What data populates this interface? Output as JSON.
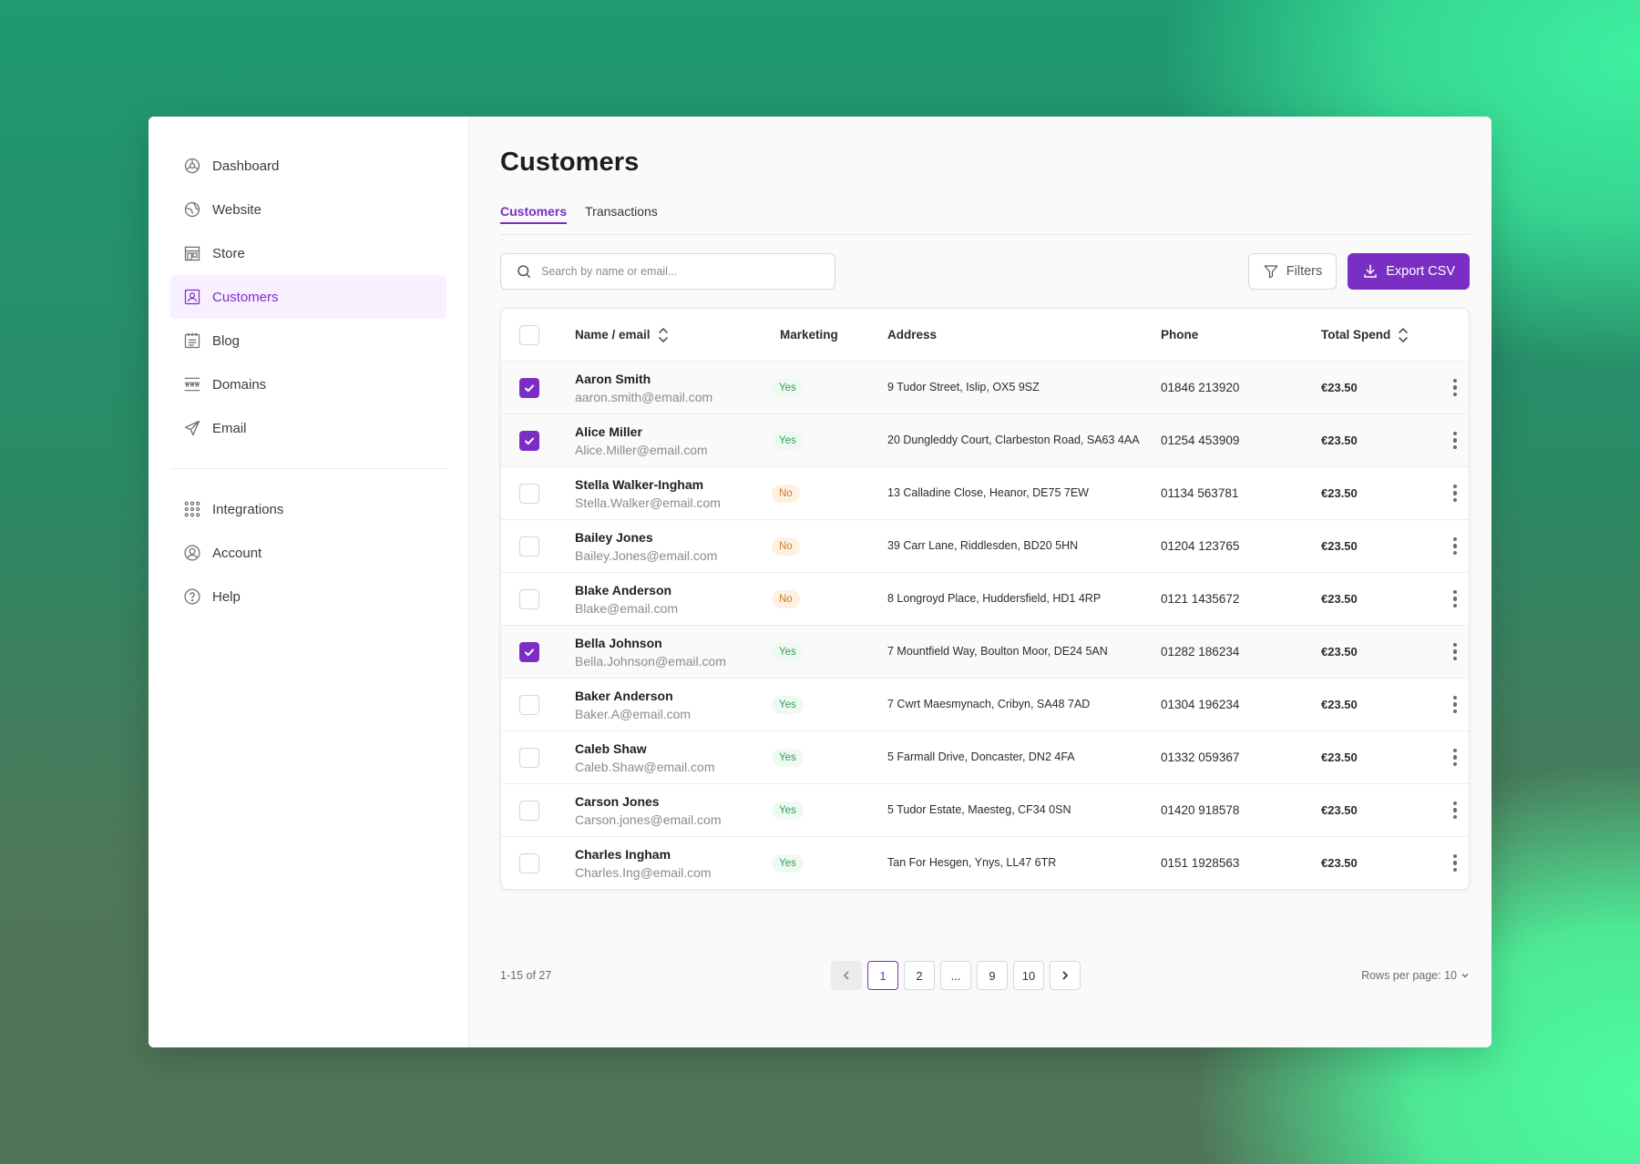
{
  "sidebar": {
    "primary": [
      {
        "label": "Dashboard",
        "icon": "dashboard-icon",
        "active": false
      },
      {
        "label": "Website",
        "icon": "globe-icon",
        "active": false
      },
      {
        "label": "Store",
        "icon": "store-icon",
        "active": false
      },
      {
        "label": "Customers",
        "icon": "user-card-icon",
        "active": true
      },
      {
        "label": "Blog",
        "icon": "blog-icon",
        "active": false
      },
      {
        "label": "Domains",
        "icon": "www-icon",
        "active": false
      },
      {
        "label": "Email",
        "icon": "send-icon",
        "active": false
      }
    ],
    "secondary": [
      {
        "label": "Integrations",
        "icon": "grid-icon",
        "active": false
      },
      {
        "label": "Account",
        "icon": "account-icon",
        "active": false
      },
      {
        "label": "Help",
        "icon": "help-icon",
        "active": false
      }
    ]
  },
  "page": {
    "title": "Customers",
    "tabs": [
      {
        "label": "Customers",
        "active": true
      },
      {
        "label": "Transactions",
        "active": false
      }
    ]
  },
  "toolbar": {
    "search_placeholder": "Search by name or email...",
    "filters_label": "Filters",
    "export_label": "Export CSV"
  },
  "table": {
    "headers": {
      "name": "Name / email",
      "marketing": "Marketing",
      "address": "Address",
      "phone": "Phone",
      "spend": "Total Spend"
    },
    "rows": [
      {
        "checked": true,
        "name": "Aaron Smith",
        "email": "aaron.smith@email.com",
        "marketing": "Yes",
        "address": "9 Tudor Street, Islip, OX5 9SZ",
        "phone": "01846 213920",
        "spend": "€23.50"
      },
      {
        "checked": true,
        "name": "Alice Miller",
        "email": "Alice.Miller@email.com",
        "marketing": "Yes",
        "address": "20 Dungleddy Court, Clarbeston Road, SA63 4AA",
        "phone": "01254 453909",
        "spend": "€23.50"
      },
      {
        "checked": false,
        "name": "Stella Walker-Ingham",
        "email": "Stella.Walker@email.com",
        "marketing": "No",
        "address": "13 Calladine Close, Heanor, DE75 7EW",
        "phone": "01134 563781",
        "spend": "€23.50"
      },
      {
        "checked": false,
        "name": "Bailey Jones",
        "email": "Bailey.Jones@email.com",
        "marketing": "No",
        "address": "39 Carr Lane, Riddlesden, BD20 5HN",
        "phone": "01204 123765",
        "spend": "€23.50"
      },
      {
        "checked": false,
        "name": "Blake Anderson",
        "email": "Blake@email.com",
        "marketing": "No",
        "address": "8 Longroyd Place, Huddersfield, HD1 4RP",
        "phone": "0121 1435672",
        "spend": "€23.50"
      },
      {
        "checked": true,
        "name": "Bella Johnson",
        "email": "Bella.Johnson@email.com",
        "marketing": "Yes",
        "address": "7 Mountfield Way, Boulton Moor, DE24 5AN",
        "phone": "01282 186234",
        "spend": "€23.50"
      },
      {
        "checked": false,
        "name": "Baker Anderson",
        "email": "Baker.A@email.com",
        "marketing": "Yes",
        "address": "7 Cwrt Maesmynach, Cribyn, SA48 7AD",
        "phone": "01304 196234",
        "spend": "€23.50"
      },
      {
        "checked": false,
        "name": "Caleb Shaw",
        "email": "Caleb.Shaw@email.com",
        "marketing": "Yes",
        "address": "5 Farmall Drive, Doncaster, DN2 4FA",
        "phone": "01332 059367",
        "spend": "€23.50"
      },
      {
        "checked": false,
        "name": "Carson Jones",
        "email": "Carson.jones@email.com",
        "marketing": "Yes",
        "address": "5 Tudor Estate, Maesteg, CF34 0SN",
        "phone": "01420 918578",
        "spend": "€23.50"
      },
      {
        "checked": false,
        "name": "Charles Ingham",
        "email": "Charles.Ing@email.com",
        "marketing": "Yes",
        "address": "Tan For Hesgen, Ynys, LL47 6TR",
        "phone": "0151 1928563",
        "spend": "€23.50"
      }
    ]
  },
  "pagination": {
    "range": "1-15 of 27",
    "pages": [
      "1",
      "2",
      "...",
      "9",
      "10"
    ],
    "current": "1",
    "rows_per_page": "Rows per page: 10"
  },
  "colors": {
    "accent": "#7b2ec4",
    "active_nav_bg": "#f8f0ff",
    "yes_badge": "#2f9e58",
    "no_badge": "#d07a1c"
  }
}
